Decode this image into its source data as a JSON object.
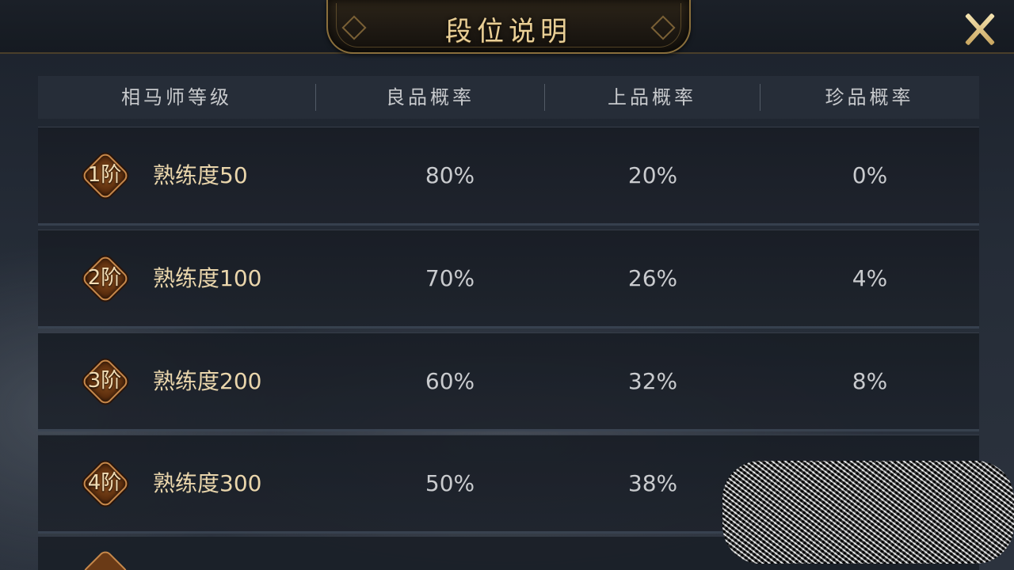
{
  "header": {
    "title": "段位说明",
    "close_icon": "close-x-icon"
  },
  "table": {
    "columns": [
      "相马师等级",
      "良品概率",
      "上品概率",
      "珍品概率"
    ],
    "rows": [
      {
        "tier": "1阶",
        "skill": "熟练度50",
        "good": "80%",
        "superior": "20%",
        "rare": "0%"
      },
      {
        "tier": "2阶",
        "skill": "熟练度100",
        "good": "70%",
        "superior": "26%",
        "rare": "4%"
      },
      {
        "tier": "3阶",
        "skill": "熟练度200",
        "good": "60%",
        "superior": "32%",
        "rare": "8%"
      },
      {
        "tier": "4阶",
        "skill": "熟练度300",
        "good": "50%",
        "superior": "38%",
        "rare": ""
      }
    ]
  },
  "colors": {
    "title_gold": "#e9cf96",
    "badge_bronze": "#8a4f1e",
    "text_light": "#c9cbce"
  }
}
